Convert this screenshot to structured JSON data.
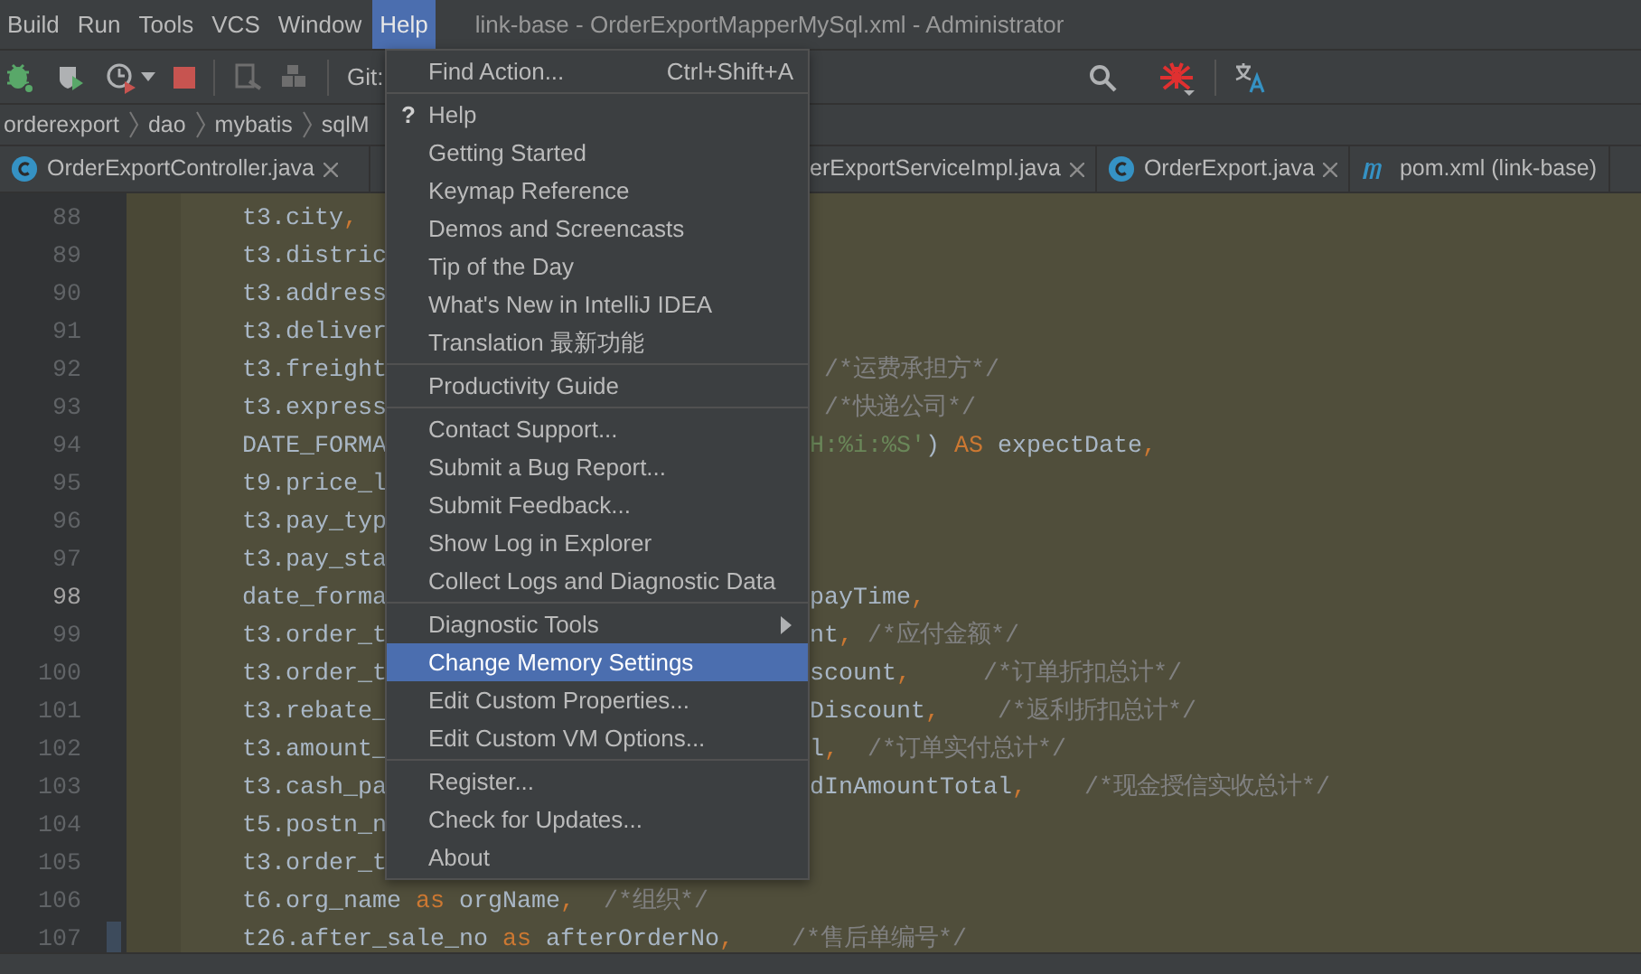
{
  "menubar": [
    {
      "label": "Build",
      "selected": false
    },
    {
      "label": "Run",
      "selected": false
    },
    {
      "label": "Tools",
      "selected": false
    },
    {
      "label": "VCS",
      "selected": false
    },
    {
      "label": "Window",
      "selected": false
    },
    {
      "label": "Help",
      "selected": true
    }
  ],
  "window": {
    "title": "link-base - OrderExportMapperMySql.xml - Administrator"
  },
  "toolbar": {
    "vcs_label": "Git:"
  },
  "breadcrumb": [
    "orderexport",
    "dao",
    "mybatis",
    "sqlM"
  ],
  "tabs": [
    {
      "label": "OrderExportController.java",
      "kind": "class",
      "closable": true
    },
    {
      "label": "erExportServiceImpl.java",
      "kind": "plain",
      "closable": true
    },
    {
      "label": "OrderExport.java",
      "kind": "class",
      "closable": true
    },
    {
      "label": "pom.xml (link-base)",
      "kind": "maven",
      "closable": false
    }
  ],
  "editor": {
    "lines": [
      {
        "number": "88",
        "current": false,
        "changed": false,
        "left": [
          {
            "text": "t3.city",
            "kind": "code"
          },
          {
            "text": ",",
            "kind": "punct"
          }
        ]
      },
      {
        "number": "89",
        "current": false,
        "changed": false,
        "left": [
          {
            "text": "t3.distric",
            "kind": "code"
          }
        ]
      },
      {
        "number": "90",
        "current": false,
        "changed": false,
        "left": [
          {
            "text": "t3.address",
            "kind": "code"
          }
        ]
      },
      {
        "number": "91",
        "current": false,
        "changed": false,
        "left": [
          {
            "text": "t3.deliver",
            "kind": "code"
          }
        ]
      },
      {
        "number": "92",
        "current": false,
        "changed": false,
        "left": [
          {
            "text": "t3.freight",
            "kind": "code"
          }
        ],
        "right": [
          {
            "text": " /*运费承担方*/",
            "kind": "comment"
          }
        ]
      },
      {
        "number": "93",
        "current": false,
        "changed": false,
        "left": [
          {
            "text": "t3.express",
            "kind": "code"
          }
        ],
        "right": [
          {
            "text": " /*快递公司*/",
            "kind": "comment"
          }
        ]
      },
      {
        "number": "94",
        "current": false,
        "changed": false,
        "left": [
          {
            "text": "DATE_FORMA",
            "kind": "code"
          }
        ],
        "right": [
          {
            "text": "H:%i:%S'",
            "kind": "string"
          },
          {
            "text": ") ",
            "kind": "code"
          },
          {
            "text": "AS",
            "kind": "keyword"
          },
          {
            "text": " expectDate",
            "kind": "code"
          },
          {
            "text": ",",
            "kind": "punct"
          }
        ]
      },
      {
        "number": "95",
        "current": false,
        "changed": false,
        "left": [
          {
            "text": "t9.price_l",
            "kind": "code"
          }
        ]
      },
      {
        "number": "96",
        "current": false,
        "changed": false,
        "left": [
          {
            "text": "t3.pay_typ",
            "kind": "code"
          }
        ]
      },
      {
        "number": "97",
        "current": false,
        "changed": false,
        "left": [
          {
            "text": "t3.pay_sta",
            "kind": "code"
          }
        ]
      },
      {
        "number": "98",
        "current": true,
        "changed": false,
        "left": [
          {
            "text": "date_forma",
            "kind": "code"
          }
        ],
        "right": [
          {
            "text": "payTime",
            "kind": "code"
          },
          {
            "text": ",",
            "kind": "punct"
          }
        ]
      },
      {
        "number": "99",
        "current": false,
        "changed": false,
        "left": [
          {
            "text": "t3.order_t",
            "kind": "code"
          }
        ],
        "right": [
          {
            "text": "nt",
            "kind": "code"
          },
          {
            "text": ",",
            "kind": "punct"
          },
          {
            "text": " /*应付金额*/",
            "kind": "comment"
          }
        ]
      },
      {
        "number": "100",
        "current": false,
        "changed": false,
        "left": [
          {
            "text": "t3.order_t",
            "kind": "code"
          }
        ],
        "right": [
          {
            "text": "scount",
            "kind": "code"
          },
          {
            "text": ",",
            "kind": "punct"
          },
          {
            "text": "     /*订单折扣总计*/",
            "kind": "comment"
          }
        ]
      },
      {
        "number": "101",
        "current": false,
        "changed": false,
        "left": [
          {
            "text": "t3.rebate_",
            "kind": "code"
          }
        ],
        "right": [
          {
            "text": "Discount",
            "kind": "code"
          },
          {
            "text": ",",
            "kind": "punct"
          },
          {
            "text": "    /*返利折扣总计*/",
            "kind": "comment"
          }
        ]
      },
      {
        "number": "102",
        "current": false,
        "changed": false,
        "left": [
          {
            "text": "t3.amount_",
            "kind": "code"
          }
        ],
        "right": [
          {
            "text": "l",
            "kind": "code"
          },
          {
            "text": ",",
            "kind": "punct"
          },
          {
            "text": "  /*订单实付总计*/",
            "kind": "comment"
          }
        ]
      },
      {
        "number": "103",
        "current": false,
        "changed": false,
        "left": [
          {
            "text": "t3.cash_pa",
            "kind": "code"
          }
        ],
        "right": [
          {
            "text": "dInAmountTotal",
            "kind": "code"
          },
          {
            "text": ",",
            "kind": "punct"
          },
          {
            "text": "    /*现金授信实收总计*/",
            "kind": "comment"
          }
        ]
      },
      {
        "number": "104",
        "current": false,
        "changed": false,
        "left": [
          {
            "text": "t5.postn_n",
            "kind": "code"
          }
        ]
      },
      {
        "number": "105",
        "current": false,
        "changed": false,
        "left": [
          {
            "text": "t3.order_t",
            "kind": "code"
          }
        ]
      },
      {
        "number": "106",
        "current": false,
        "changed": false,
        "left": [
          {
            "text": "t6.org_name ",
            "kind": "code"
          },
          {
            "text": "as",
            "kind": "keyword"
          },
          {
            "text": " orgName",
            "kind": "code"
          },
          {
            "text": ",",
            "kind": "punct"
          },
          {
            "text": "  /*组织*/",
            "kind": "comment"
          }
        ]
      },
      {
        "number": "107",
        "current": false,
        "changed": true,
        "left": [
          {
            "text": "t26.after_sale_no ",
            "kind": "code"
          },
          {
            "text": "as",
            "kind": "keyword"
          },
          {
            "text": " afterOrderNo",
            "kind": "code"
          },
          {
            "text": ",",
            "kind": "punct"
          },
          {
            "text": "    /*售后单编号*/",
            "kind": "comment"
          }
        ]
      }
    ]
  },
  "help_menu": {
    "items": [
      {
        "kind": "item",
        "label": "Find Action...",
        "shortcut": "Ctrl+Shift+A",
        "selected": false
      },
      {
        "kind": "separator"
      },
      {
        "kind": "item",
        "icon": "?",
        "label": "Help",
        "selected": false
      },
      {
        "kind": "item",
        "label": "Getting Started",
        "selected": false
      },
      {
        "kind": "item",
        "label": "Keymap Reference",
        "selected": false
      },
      {
        "kind": "item",
        "label": "Demos and Screencasts",
        "selected": false
      },
      {
        "kind": "item",
        "label": "Tip of the Day",
        "selected": false
      },
      {
        "kind": "item",
        "label": "What's New in IntelliJ IDEA",
        "selected": false
      },
      {
        "kind": "item",
        "label": "Translation 最新功能",
        "selected": false
      },
      {
        "kind": "separator"
      },
      {
        "kind": "item",
        "label": "Productivity Guide",
        "selected": false
      },
      {
        "kind": "separator"
      },
      {
        "kind": "item",
        "label": "Contact Support...",
        "selected": false
      },
      {
        "kind": "item",
        "label": "Submit a Bug Report...",
        "selected": false
      },
      {
        "kind": "item",
        "label": "Submit Feedback...",
        "selected": false
      },
      {
        "kind": "item",
        "label": "Show Log in Explorer",
        "selected": false
      },
      {
        "kind": "item",
        "label": "Collect Logs and Diagnostic Data",
        "selected": false
      },
      {
        "kind": "separator"
      },
      {
        "kind": "item",
        "label": "Diagnostic Tools",
        "submenu": true,
        "selected": false
      },
      {
        "kind": "item",
        "label": "Change Memory Settings",
        "selected": true
      },
      {
        "kind": "item",
        "label": "Edit Custom Properties...",
        "selected": false
      },
      {
        "kind": "item",
        "label": "Edit Custom VM Options...",
        "selected": false
      },
      {
        "kind": "separator"
      },
      {
        "kind": "item",
        "label": "Register...",
        "selected": false
      },
      {
        "kind": "item",
        "label": "Check for Updates...",
        "selected": false
      },
      {
        "kind": "item",
        "label": "About",
        "selected": false
      }
    ]
  }
}
